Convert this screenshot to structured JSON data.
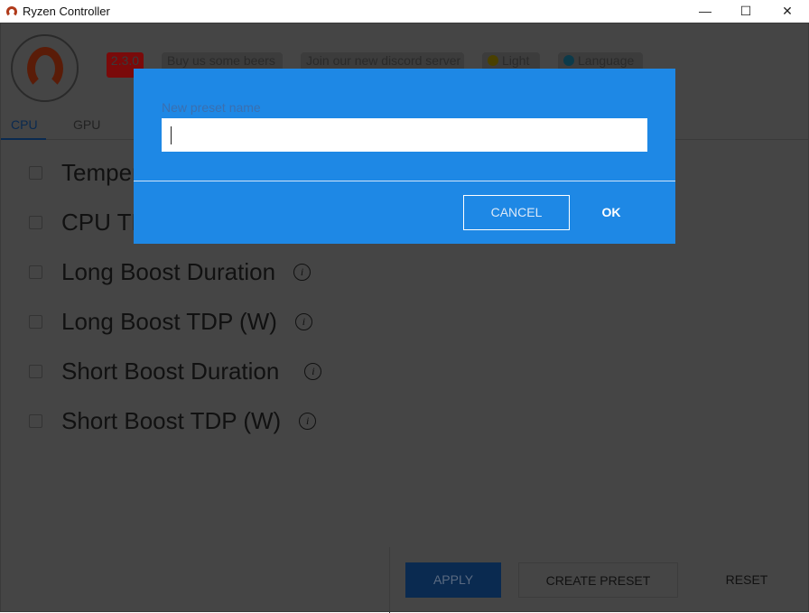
{
  "window": {
    "title": "Ryzen Controller",
    "minimize": "—",
    "maximize": "☐",
    "close": "✕"
  },
  "header": {
    "version": "2.3.0",
    "beers": "Buy us some beers",
    "discord": "Join our new discord server",
    "theme": "Light",
    "language": "Language"
  },
  "tabs": [
    {
      "label": "CPU",
      "active": true
    },
    {
      "label": "GPU",
      "active": false
    }
  ],
  "settings": [
    {
      "label": "Temperature limit"
    },
    {
      "label": "CPU TDP (W)"
    },
    {
      "label": "Long Boost Duration"
    },
    {
      "label": "Long Boost TDP (W)"
    },
    {
      "label": "Short Boost Duration"
    },
    {
      "label": "Short Boost TDP (W)"
    }
  ],
  "info_glyph": "i",
  "footer": {
    "apply": "APPLY",
    "create_preset": "CREATE PRESET",
    "reset": "RESET"
  },
  "dialog": {
    "label": "New preset name",
    "value": "",
    "cancel": "CANCEL",
    "ok": "OK"
  },
  "colors": {
    "accent": "#1e88e5",
    "version_badge": "#dd0000"
  }
}
